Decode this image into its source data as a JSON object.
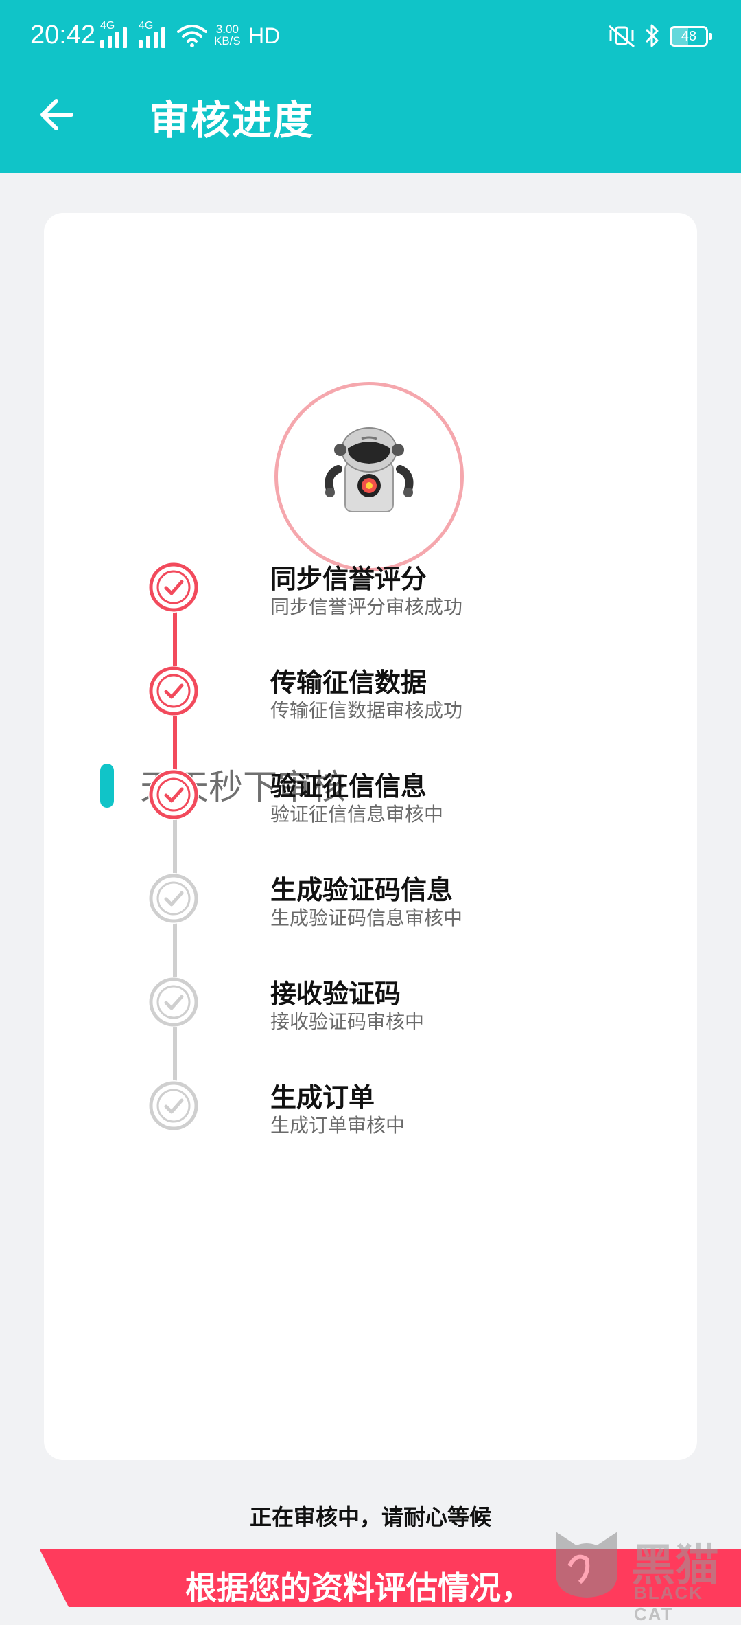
{
  "status_bar": {
    "time": "20:42",
    "signal1_label": "4G",
    "signal2_label": "4G",
    "speed_value": "3.00",
    "speed_unit": "KB/S",
    "hd_label": "HD",
    "battery": "48"
  },
  "header": {
    "title": "审核进度",
    "back_icon": "arrow-left-icon"
  },
  "robot": {
    "icon": "robot-icon"
  },
  "section": {
    "title": "天天秒下审核"
  },
  "colors": {
    "accent": "#10c4c8",
    "done": "#f24a5c",
    "pending": "#cfcfcf",
    "banner": "#ff3b5c"
  },
  "steps": [
    {
      "title": "同步信誉评分",
      "subtitle": "同步信誉评分审核成功",
      "status": "done"
    },
    {
      "title": "传输征信数据",
      "subtitle": "传输征信数据审核成功",
      "status": "done"
    },
    {
      "title": "验证征信信息",
      "subtitle": "验证征信信息审核中",
      "status": "done"
    },
    {
      "title": "生成验证码信息",
      "subtitle": "生成验证码信息审核中",
      "status": "pending"
    },
    {
      "title": "接收验证码",
      "subtitle": "接收验证码审核中",
      "status": "pending"
    },
    {
      "title": "生成订单",
      "subtitle": "生成订单审核中",
      "status": "pending"
    }
  ],
  "footer_note": "正在审核中，请耐心等候",
  "banner_text": "根据您的资料评估情况，",
  "watermark": {
    "text": "黑猫",
    "sub": "BLACK CAT"
  }
}
